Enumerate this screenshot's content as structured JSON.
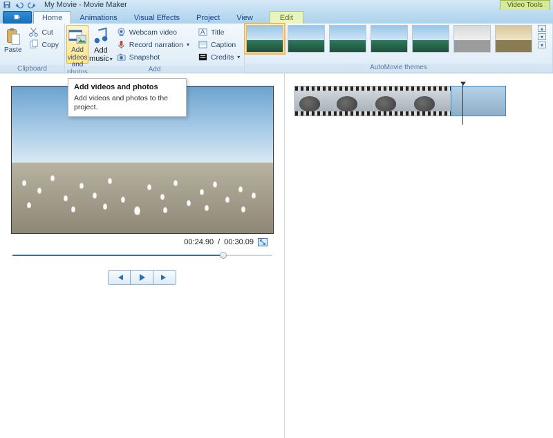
{
  "window": {
    "title": "My Movie - Movie Maker"
  },
  "contextual_tab_group": "Video Tools",
  "tabs": [
    "Home",
    "Animations",
    "Visual Effects",
    "Project",
    "View"
  ],
  "contextual_tab": "Edit",
  "active_tab": "Home",
  "ribbon": {
    "clipboard": {
      "label": "Clipboard",
      "paste": "Paste",
      "cut": "Cut",
      "copy": "Copy"
    },
    "add": {
      "label": "Add",
      "add_videos": "Add videos and photos",
      "add_music": "Add music",
      "webcam": "Webcam video",
      "narration": "Record narration",
      "snapshot": "Snapshot",
      "title": "Title",
      "caption": "Caption",
      "credits": "Credits"
    },
    "automovie": {
      "label": "AutoMovie themes"
    }
  },
  "tooltip": {
    "title": "Add videos and photos",
    "body": "Add videos and photos to the project."
  },
  "preview": {
    "time_current": "00:24.90",
    "time_total": "00:30.09",
    "separator": "/"
  }
}
